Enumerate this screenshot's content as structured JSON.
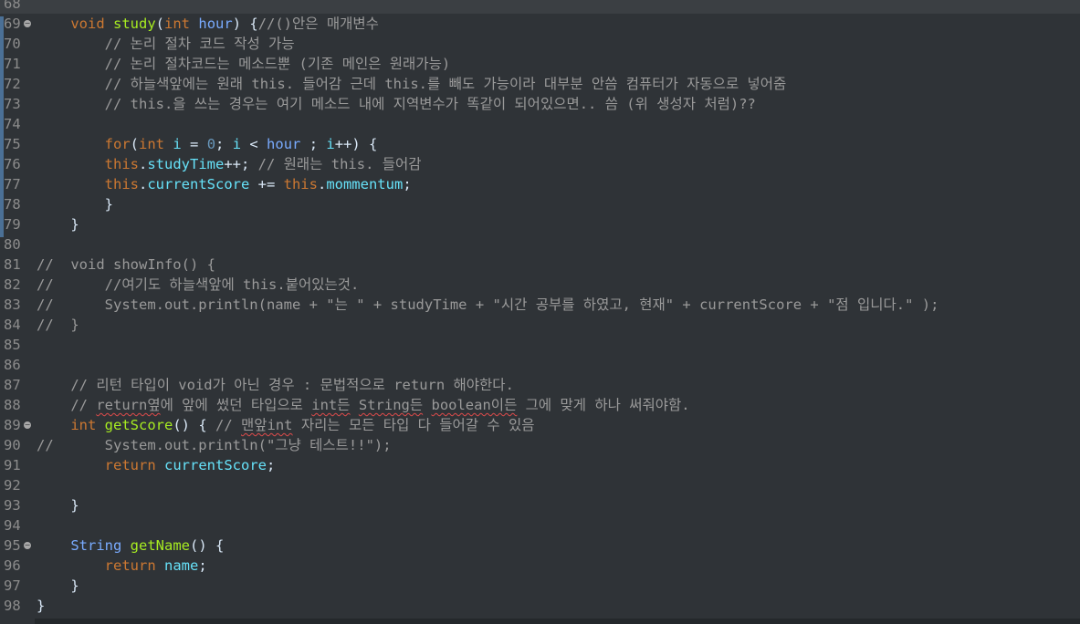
{
  "editor": {
    "lines": [
      {
        "n": "68",
        "code": "",
        "current": true
      },
      {
        "n": "69",
        "code": "",
        "fold": true
      },
      {
        "n": "70",
        "code": "        // 논리 절차 코드 작성 가능"
      },
      {
        "n": "71",
        "code": "        // 논리 절차코드는 메소드뿐 (기존 메인은 원래가능)"
      },
      {
        "n": "72",
        "code": "        // 하늘색앞에는 원래 this. 들어감 근데 this.를 빼도 가능이라 대부분 안씀 컴퓨터가 자동으로 넣어줌"
      },
      {
        "n": "73",
        "code": "        // this.을 쓰는 경우는 여기 메소드 내에 지역변수가 똑같이 되어있으면.. 씀 (위 생성자 처럼)??"
      },
      {
        "n": "74",
        "code": ""
      },
      {
        "n": "75",
        "code": ""
      },
      {
        "n": "76",
        "code": ""
      },
      {
        "n": "77",
        "code": ""
      },
      {
        "n": "78",
        "code": "        }"
      },
      {
        "n": "79",
        "code": "    }"
      },
      {
        "n": "80",
        "code": ""
      },
      {
        "n": "81",
        "code": "//  void showInfo() {"
      },
      {
        "n": "82",
        "code": "//      //여기도 하늘색앞에 this.붙어있는것."
      },
      {
        "n": "83",
        "code": "//      System.out.println(name + \"는 \" + studyTime + \"시간 공부를 하였고, 현재\" + currentScore + \"점 입니다.\" );"
      },
      {
        "n": "84",
        "code": "//  }"
      },
      {
        "n": "85",
        "code": ""
      },
      {
        "n": "86",
        "code": ""
      },
      {
        "n": "87",
        "code": "    // 리턴 타입이 void가 아닌 경우 : 문법적으로 return 해야한다."
      },
      {
        "n": "88",
        "code": ""
      },
      {
        "n": "89",
        "code": "",
        "fold": true
      },
      {
        "n": "90",
        "code": "//      System.out.println(\"그냥 테스트!!\");"
      },
      {
        "n": "91",
        "code": ""
      },
      {
        "n": "92",
        "code": ""
      },
      {
        "n": "93",
        "code": "    }"
      },
      {
        "n": "94",
        "code": ""
      },
      {
        "n": "95",
        "code": "",
        "fold": true
      },
      {
        "n": "96",
        "code": ""
      },
      {
        "n": "97",
        "code": "    }"
      },
      {
        "n": "98",
        "code": "}"
      }
    ],
    "tokens": {
      "l69": [
        "    ",
        "void",
        " ",
        "study",
        "(",
        "int",
        " ",
        "hour",
        ") {",
        "//()안은 매개변수"
      ],
      "l75": [
        "        ",
        "for",
        "(",
        "int",
        " ",
        "i",
        " = ",
        "0",
        "; ",
        "i",
        " < ",
        "hour",
        " ; ",
        "i",
        "++) {"
      ],
      "l76": [
        "        ",
        "this",
        ".",
        "studyTime",
        "++; ",
        "// 원래는 this. 들어감"
      ],
      "l77": [
        "        ",
        "this",
        ".",
        "currentScore",
        " += ",
        "this",
        ".",
        "mommentum",
        ";"
      ],
      "l88": [
        "    // ",
        "return옆",
        "에 앞에 썼던 타입으로 ",
        "int든",
        " ",
        "String든",
        " ",
        "boolean이든",
        " 그에 맞게 하나 써줘야함."
      ],
      "l89": [
        "    ",
        "int",
        " ",
        "getScore",
        "() { ",
        "// ",
        "맨앞int",
        " 자리는 모든 타입 다 들어갈 수 있음"
      ],
      "l91": [
        "        ",
        "return",
        " ",
        "currentScore",
        ";"
      ],
      "l95": [
        "    ",
        "String",
        " ",
        "getName",
        "() {"
      ],
      "l96": [
        "        ",
        "return",
        " ",
        "name",
        ";"
      ]
    }
  }
}
